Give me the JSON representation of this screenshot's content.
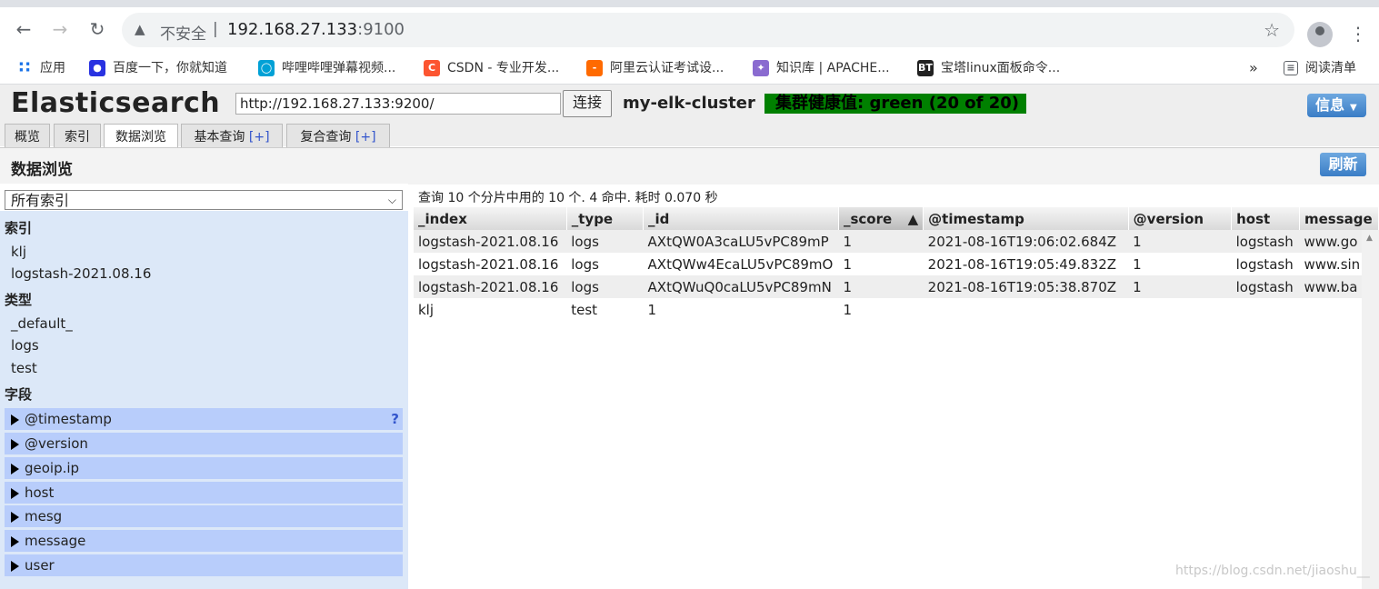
{
  "browser": {
    "security_label": "不安全",
    "url_host": "192.168.27.133",
    "url_port": ":9100",
    "bookmarks": [
      {
        "label": "应用",
        "icon": "apps-grid-icon"
      },
      {
        "label": "百度一下，你就知道",
        "icon": "baidu-icon"
      },
      {
        "label": "哔哩哔哩弹幕视频...",
        "icon": "bilibili-icon"
      },
      {
        "label": "CSDN - 专业开发...",
        "icon": "csdn-icon"
      },
      {
        "label": "阿里云认证考试设...",
        "icon": "aliyun-icon"
      },
      {
        "label": "知识库 | APACHE...",
        "icon": "apache-icon"
      },
      {
        "label": "宝塔linux面板命令...",
        "icon": "bt-icon"
      }
    ],
    "more_label": "»",
    "reading_list_label": "阅读清单"
  },
  "app": {
    "title": "Elasticsearch",
    "connect_url": "http://192.168.27.133:9200/",
    "connect_label": "连接",
    "cluster_name": "my-elk-cluster",
    "health_label": "集群健康值: green (20 of 20)",
    "health_color": "#008000",
    "info_label": "信息",
    "tabs": [
      {
        "label": "概览",
        "plus": ""
      },
      {
        "label": "索引",
        "plus": ""
      },
      {
        "label": "数据浏览",
        "plus": ""
      },
      {
        "label": "基本查询",
        "plus": "[+]"
      },
      {
        "label": "复合查询",
        "plus": "[+]"
      }
    ],
    "active_tab": "数据浏览",
    "section_title": "数据浏览",
    "refresh_label": "刷新"
  },
  "sidebar": {
    "index_select": "所有索引",
    "indices_heading": "索引",
    "indices": [
      "klj",
      "logstash-2021.08.16"
    ],
    "types_heading": "类型",
    "types": [
      "_default_",
      "logs",
      "test"
    ],
    "fields_heading": "字段",
    "fields": [
      "@timestamp",
      "@version",
      "geoip.ip",
      "host",
      "mesg",
      "message",
      "user"
    ],
    "field_help": "?"
  },
  "results": {
    "summary": "查询 10 个分片中用的 10 个. 4 命中. 耗时 0.070 秒",
    "columns": [
      "_index",
      "_type",
      "_id",
      "_score",
      "@timestamp",
      "@version",
      "host",
      "message"
    ],
    "sort_indicator": "▲",
    "rows": [
      [
        "logstash-2021.08.16",
        "logs",
        "AXtQW0A3caLU5vPC89mP",
        "1",
        "2021-08-16T19:06:02.684Z",
        "1",
        "logstash",
        "www.go"
      ],
      [
        "logstash-2021.08.16",
        "logs",
        "AXtQWw4EcaLU5vPC89mO",
        "1",
        "2021-08-16T19:05:49.832Z",
        "1",
        "logstash",
        "www.sin"
      ],
      [
        "logstash-2021.08.16",
        "logs",
        "AXtQWuQ0caLU5vPC89mN",
        "1",
        "2021-08-16T19:05:38.870Z",
        "1",
        "logstash",
        "www.ba"
      ],
      [
        "klj",
        "test",
        "1",
        "1",
        "",
        "",
        "",
        ""
      ]
    ]
  },
  "watermark": "https://blog.csdn.net/jiaoshu__"
}
